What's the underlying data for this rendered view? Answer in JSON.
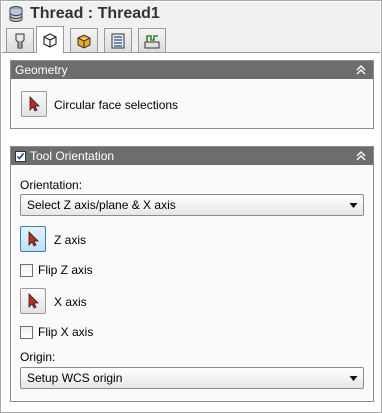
{
  "window": {
    "title": "Thread : Thread1",
    "title_icon": "database-stack-icon"
  },
  "tabs": [
    {
      "icon": "tool-icon",
      "active": false
    },
    {
      "icon": "cube-outline-icon",
      "active": true
    },
    {
      "icon": "cube-orange-icon",
      "active": false
    },
    {
      "icon": "passes-list-icon",
      "active": false
    },
    {
      "icon": "linking-icon",
      "active": false
    }
  ],
  "geometry": {
    "header": "Geometry",
    "selection_label": "Circular face selections"
  },
  "tool_orientation": {
    "header": "Tool Orientation",
    "header_checked": true,
    "orientation_label": "Orientation:",
    "orientation_value": "Select Z axis/plane & X axis",
    "z_axis_label": "Z axis",
    "flip_z_label": "Flip Z axis",
    "x_axis_label": "X axis",
    "flip_x_label": "Flip X axis",
    "origin_label": "Origin:",
    "origin_value": "Setup WCS origin"
  },
  "colors": {
    "panel_header": "#6d6d6d",
    "active_button": "#bfe0f5",
    "pointer_red": "#c62828"
  }
}
